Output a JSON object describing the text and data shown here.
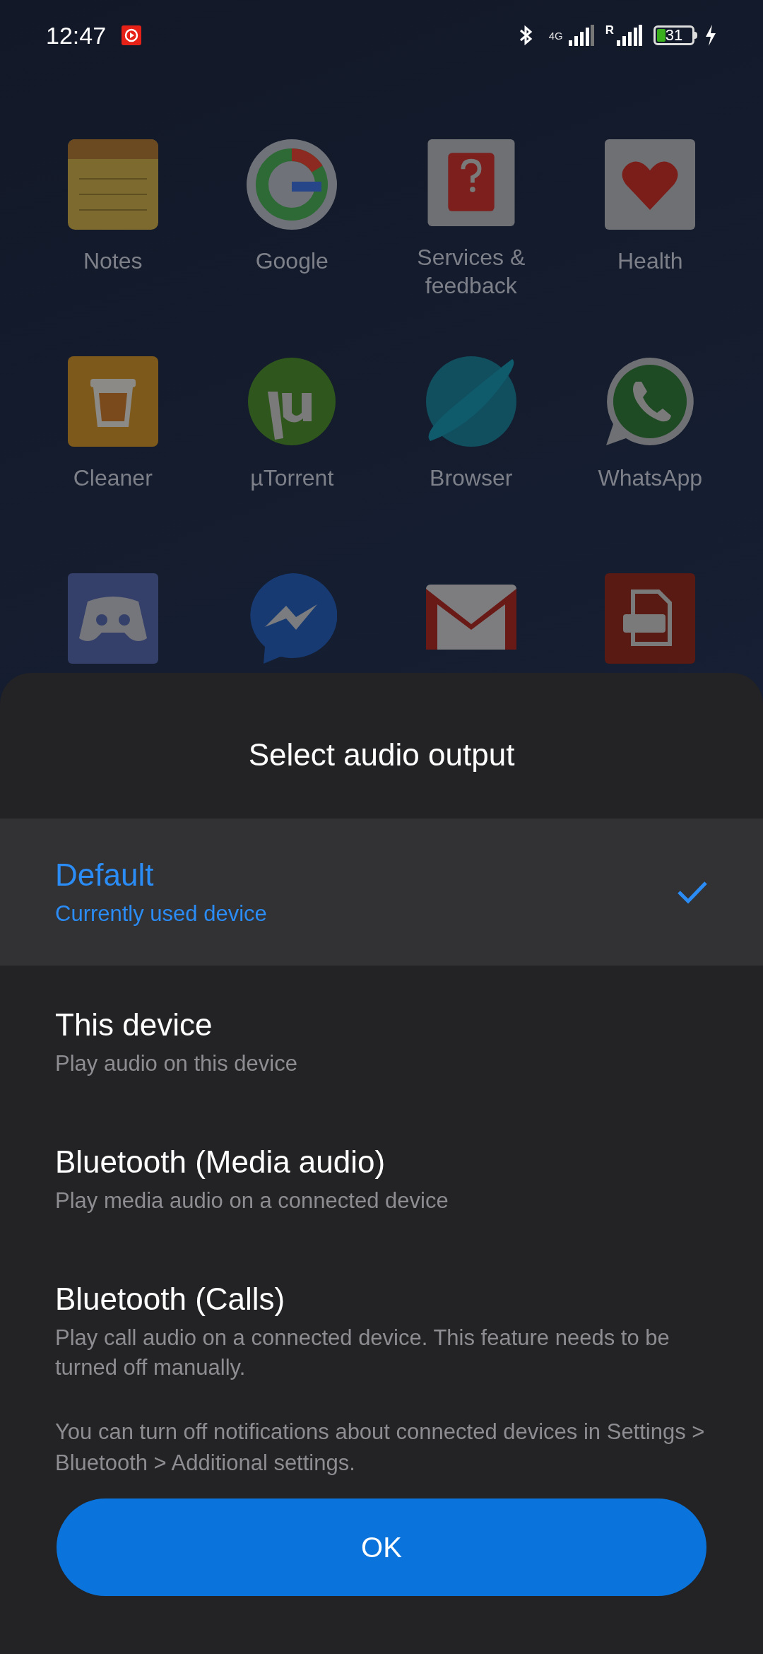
{
  "status_bar": {
    "time": "12:47",
    "network_type": "4G",
    "roaming": "R",
    "battery": "31",
    "charging": true
  },
  "apps": [
    {
      "kind": "notepad",
      "label": "Notes"
    },
    {
      "kind": "g-circle",
      "label": "Google"
    },
    {
      "kind": "help-tag",
      "label": "Services & feedback"
    },
    {
      "kind": "heart",
      "label": "Health"
    },
    {
      "kind": "bin",
      "label": "Cleaner"
    },
    {
      "kind": "mu-circle",
      "label": "µTorrent"
    },
    {
      "kind": "planet",
      "label": "Browser"
    },
    {
      "kind": "chat-phone",
      "label": "WhatsApp"
    },
    {
      "kind": "gamepad"
    },
    {
      "kind": "chat-bolt"
    },
    {
      "kind": "envelope"
    },
    {
      "kind": "file-doc"
    }
  ],
  "dialog": {
    "title": "Select audio output",
    "options": [
      {
        "title": "Default",
        "subtitle": "Currently used device",
        "selected": true
      },
      {
        "title": "This device",
        "subtitle": "Play audio on this device",
        "selected": false
      },
      {
        "title": "Bluetooth (Media audio)",
        "subtitle": "Play media audio on a connected device",
        "selected": false
      },
      {
        "title": "Bluetooth (Calls)",
        "subtitle": "Play call audio on a connected device. This feature needs to be turned off manually.",
        "selected": false
      }
    ],
    "note": "You can turn off notifications about connected devices in Settings > Bluetooth > Additional settings.",
    "button": "OK"
  }
}
